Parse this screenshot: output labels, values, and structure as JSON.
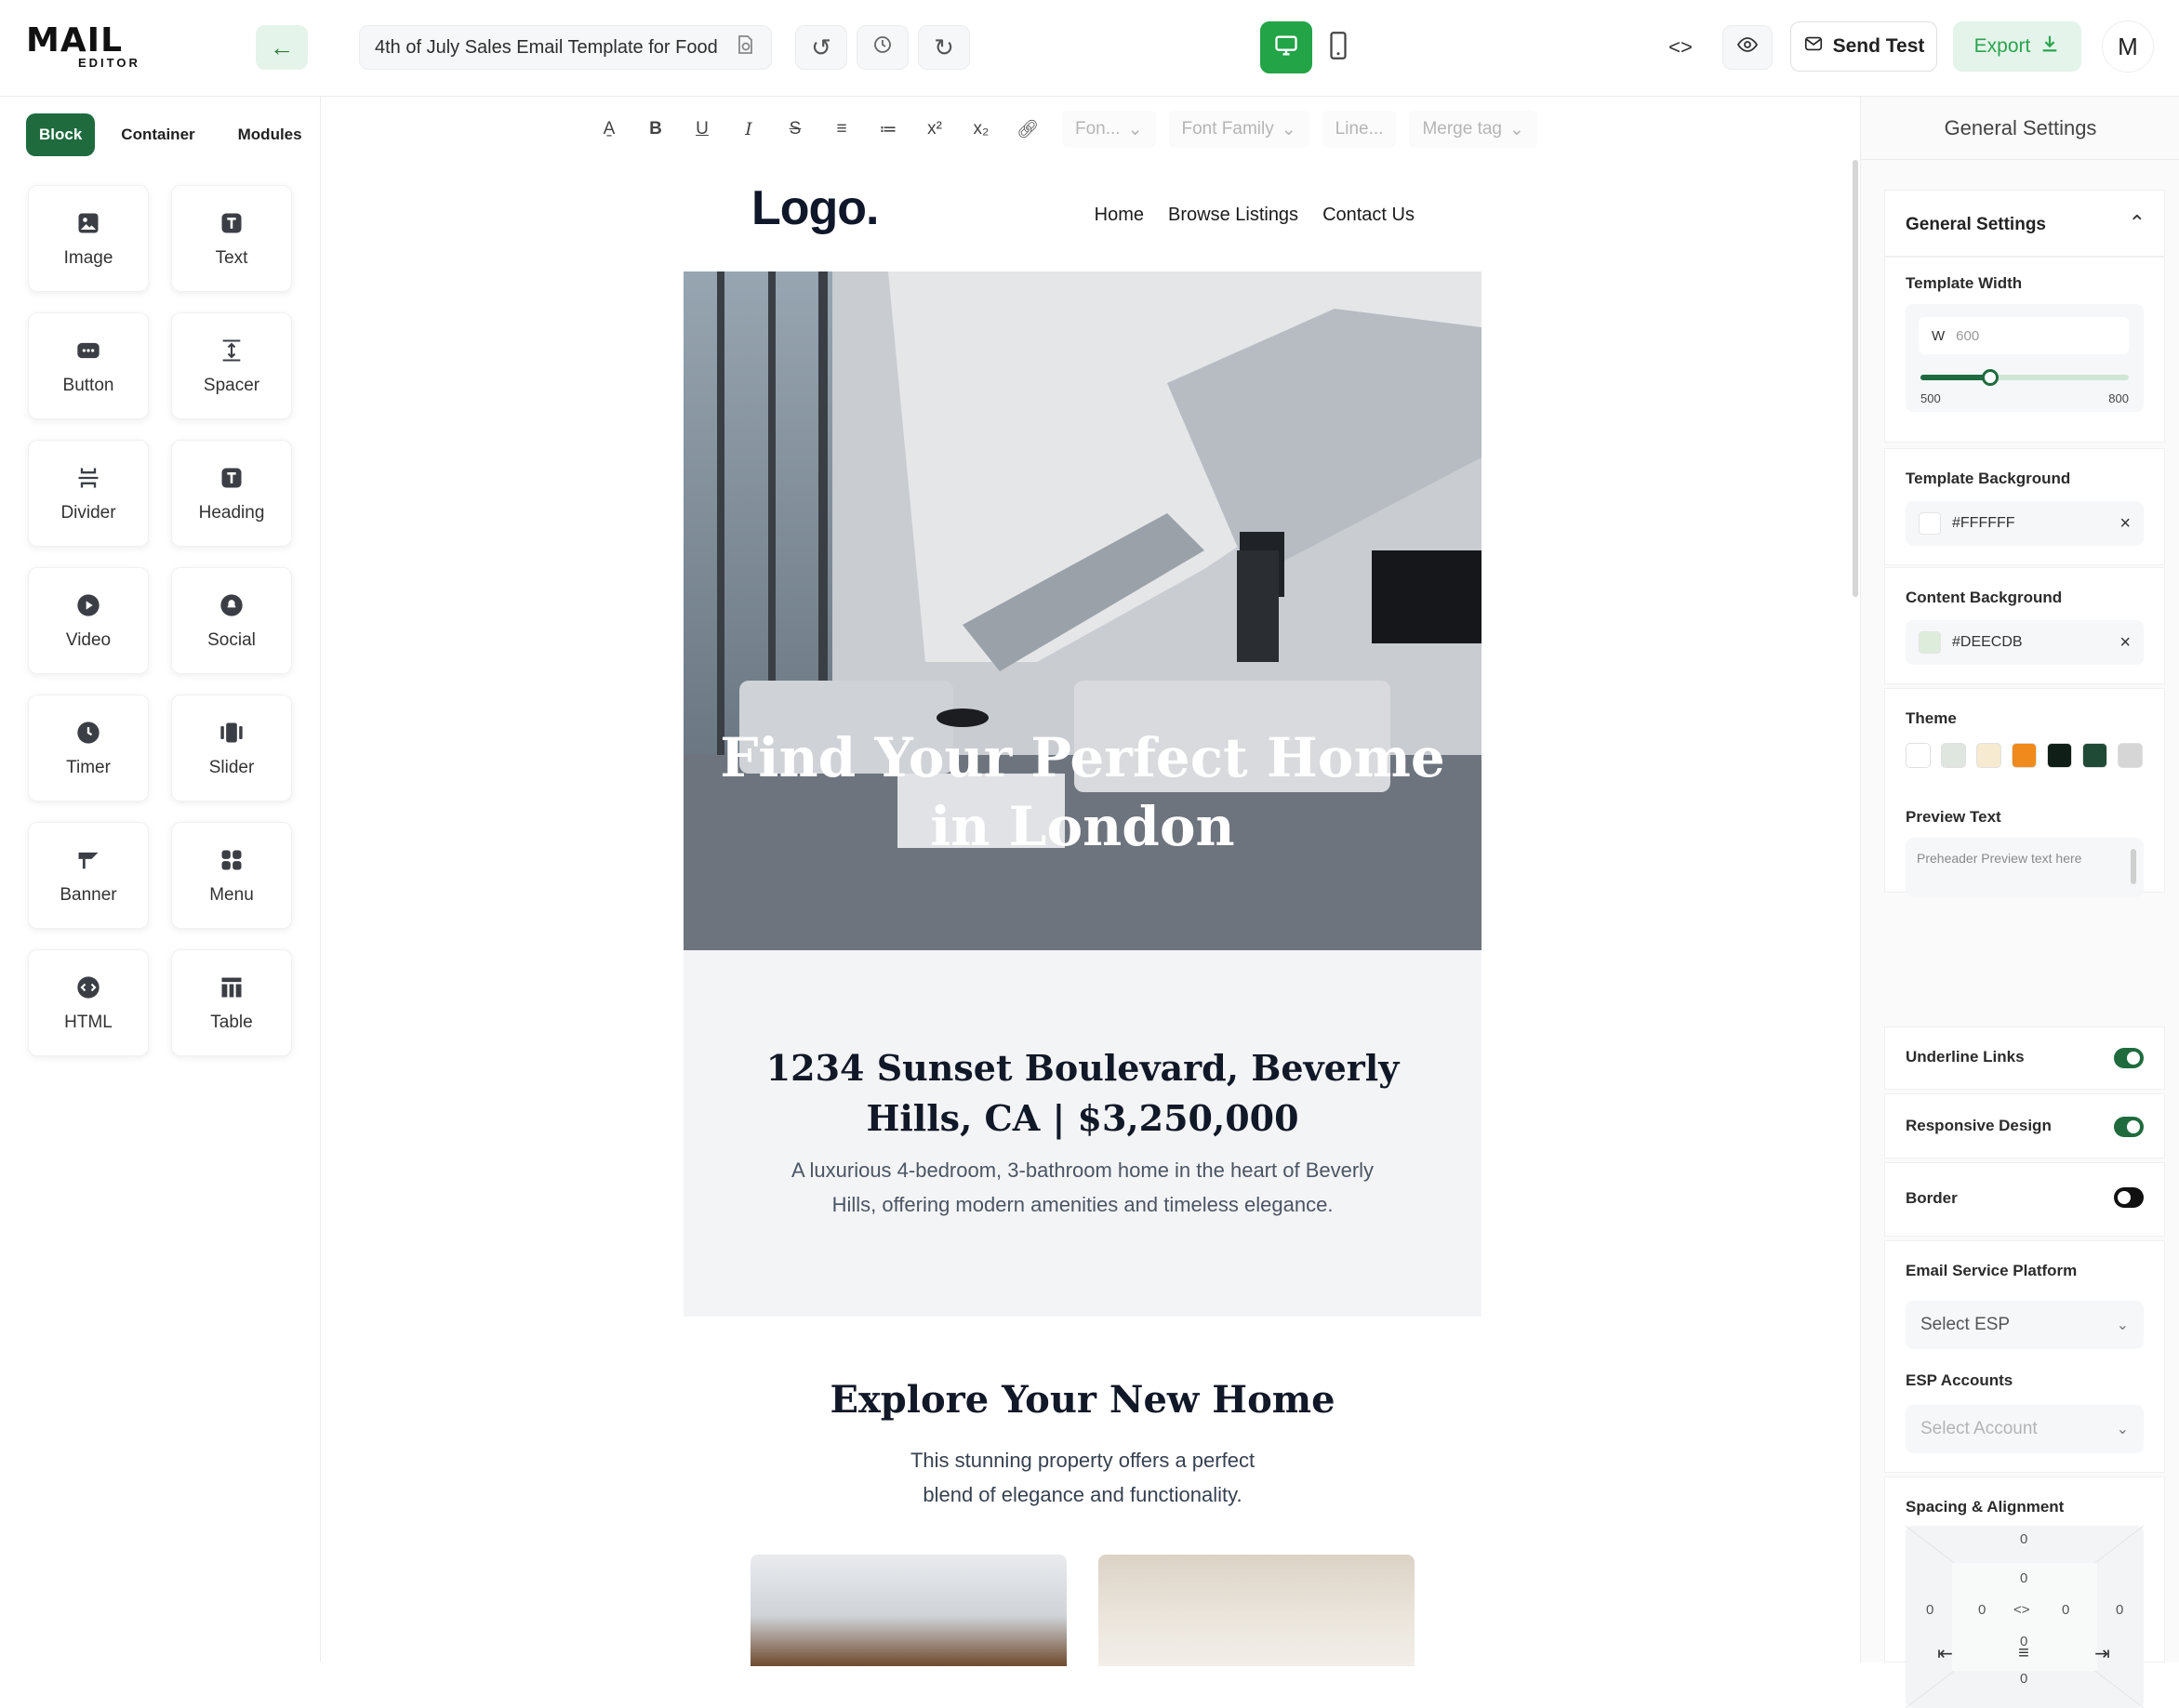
{
  "app": {
    "logo_text": "MAIL",
    "logo_sub": "EDITOR",
    "template_name": "4th of July Sales Email Template for Food",
    "send_test_label": "Send Test",
    "export_label": "Export",
    "user_initial": "M",
    "view_mode": "desktop"
  },
  "sidebar": {
    "tabs": [
      {
        "label": "Block",
        "active": true
      },
      {
        "label": "Container",
        "active": false
      },
      {
        "label": "Modules",
        "active": false
      }
    ],
    "blocks": [
      {
        "label": "Image",
        "icon": "image-icon"
      },
      {
        "label": "Text",
        "icon": "text-icon"
      },
      {
        "label": "Button",
        "icon": "button-icon"
      },
      {
        "label": "Spacer",
        "icon": "spacer-icon"
      },
      {
        "label": "Divider",
        "icon": "divider-icon"
      },
      {
        "label": "Heading",
        "icon": "heading-icon"
      },
      {
        "label": "Video",
        "icon": "video-icon"
      },
      {
        "label": "Social",
        "icon": "social-icon"
      },
      {
        "label": "Timer",
        "icon": "timer-icon"
      },
      {
        "label": "Slider",
        "icon": "slider-icon"
      },
      {
        "label": "Banner",
        "icon": "banner-icon"
      },
      {
        "label": "Menu",
        "icon": "menu-icon"
      },
      {
        "label": "HTML",
        "icon": "html-icon"
      },
      {
        "label": "Table",
        "icon": "table-icon"
      }
    ]
  },
  "format_toolbar": {
    "font_size_placeholder": "Fon...",
    "font_family_placeholder": "Font Family",
    "line_height_placeholder": "Line...",
    "merge_tag_placeholder": "Merge tag"
  },
  "email": {
    "logo": "Logo.",
    "nav": [
      "Home",
      "Browse Listings",
      "Contact Us"
    ],
    "hero_title": "Find Your Perfect Home in London",
    "listing_title": "1234 Sunset Boulevard, Beverly Hills, CA | $3,250,000",
    "listing_desc": "A luxurious 4-bedroom, 3-bathroom home in the heart of Beverly Hills, offering modern amenities and timeless elegance.",
    "explore_title": "Explore Your New Home",
    "explore_desc": "This stunning property offers a perfect blend of elegance and functionality."
  },
  "settings": {
    "panel_title": "General Settings",
    "section_title": "General Settings",
    "template_width_label": "Template Width",
    "width_prefix": "W",
    "width_value": "600",
    "width_min": "500",
    "width_max": "800",
    "width_fraction": 0.333,
    "template_bg_label": "Template Background",
    "template_bg_value": "#FFFFFF",
    "content_bg_label": "Content Background",
    "content_bg_value": "#DEECDB",
    "theme_label": "Theme",
    "theme_colors": [
      "#ffffff",
      "#dfe6df",
      "#f6ead0",
      "#f08a1c",
      "#0f1f17",
      "#1f4a36",
      "#d6d6d6"
    ],
    "preview_text_label": "Preview Text",
    "preview_text_placeholder": "Preheader Preview text here",
    "underline_links_label": "Underline Links",
    "underline_links": true,
    "responsive_label": "Responsive Design",
    "responsive": true,
    "border_label": "Border",
    "border": false,
    "esp_label": "Email Service Platform",
    "esp_placeholder": "Select ESP",
    "esp_accounts_label": "ESP Accounts",
    "esp_accounts_placeholder": "Select Account",
    "spacing_label": "Spacing & Alignment",
    "spacing": {
      "m_top": "0",
      "m_left": "0",
      "m_right": "0",
      "m_bottom": "0",
      "p_top": "0",
      "p_left": "0",
      "p_right": "0",
      "p_bottom": "0",
      "link": "<>"
    }
  },
  "colors": {
    "brand_green": "#22a447",
    "dark_green": "#1f6b3e"
  }
}
